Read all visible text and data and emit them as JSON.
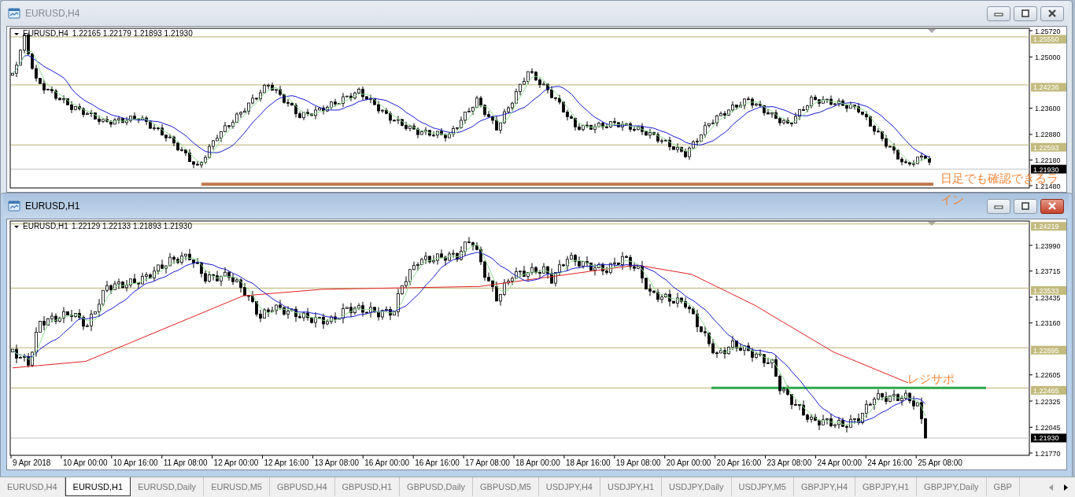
{
  "windows": [
    {
      "title": "EURUSD,H4",
      "active": false,
      "symbol": "EURUSD,H4",
      "ohlc": "1.22165 1.22179 1.21893 1.21930",
      "price_axis": [
        "1.25720",
        "1.25000",
        "1.23600",
        "1.22880",
        "1.22180",
        "1.21480"
      ],
      "levels": [
        "1.25550",
        "1.24236",
        "1.22593"
      ],
      "current_price": "1.21930",
      "annotations": [
        "日足でも確認できるラ",
        "イン"
      ]
    },
    {
      "title": "EURUSD,H1",
      "active": true,
      "symbol": "EURUSD,H1",
      "ohlc": "1.22129 1.22133 1.21893 1.21930",
      "price_axis": [
        "1.23990",
        "1.23715",
        "1.23435",
        "1.23160",
        "1.22605",
        "1.22325",
        "1.22045",
        "1.21770"
      ],
      "levels": [
        "1.24219",
        "1.23533",
        "1.22895",
        "1.22465"
      ],
      "current_price": "1.21930",
      "time_axis": [
        "9 Apr 2018",
        "10 Apr 00:00",
        "10 Apr 16:00",
        "11 Apr 08:00",
        "12 Apr 00:00",
        "12 Apr 16:00",
        "13 Apr 08:00",
        "16 Apr 00:00",
        "16 Apr 16:00",
        "17 Apr 08:00",
        "18 Apr 00:00",
        "18 Apr 16:00",
        "19 Apr 08:00",
        "20 Apr 00:00",
        "20 Apr 16:00",
        "23 Apr 08:00",
        "24 Apr 00:00",
        "24 Apr 16:00",
        "25 Apr 08:00"
      ],
      "annotations": [
        "レジサポ"
      ]
    }
  ],
  "tabs": [
    {
      "label": "EURUSD,H4",
      "selected": false
    },
    {
      "label": "EURUSD,H1",
      "selected": true
    },
    {
      "label": "EURUSD,Daily",
      "selected": false
    },
    {
      "label": "EURUSD,M5",
      "selected": false
    },
    {
      "label": "GBPUSD,H4",
      "selected": false
    },
    {
      "label": "GBPUSD,H1",
      "selected": false
    },
    {
      "label": "GBPUSD,Daily",
      "selected": false
    },
    {
      "label": "GBPUSD,M5",
      "selected": false
    },
    {
      "label": "USDJPY,H4",
      "selected": false
    },
    {
      "label": "USDJPY,H1",
      "selected": false
    },
    {
      "label": "USDJPY,Daily",
      "selected": false
    },
    {
      "label": "USDJPY,M5",
      "selected": false
    },
    {
      "label": "GBPJPY,H4",
      "selected": false
    },
    {
      "label": "GBPJPY,H1",
      "selected": false
    },
    {
      "label": "GBPJPY,Daily",
      "selected": false
    },
    {
      "label": "GBP",
      "selected": false
    }
  ]
}
